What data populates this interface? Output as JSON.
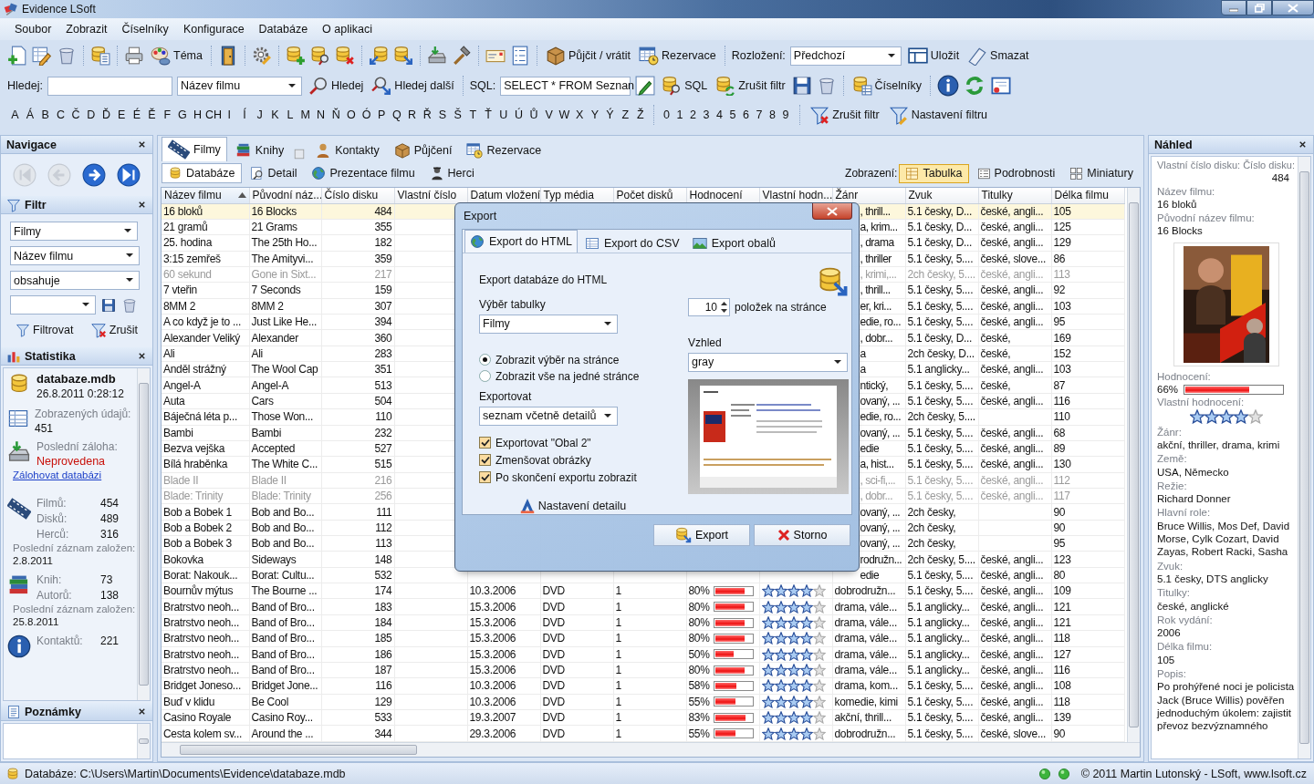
{
  "window": {
    "title": "Evidence LSoft"
  },
  "menu": [
    "Soubor",
    "Zobrazit",
    "Číselníky",
    "Konfigurace",
    "Databáze",
    "O aplikaci"
  ],
  "toolbar": {
    "theme": "Téma",
    "lend": "Půjčit / vrátit",
    "reserve": "Rezervace",
    "layout_label": "Rozložení:",
    "layout_value": "Předchozí",
    "save": "Uložit",
    "delete": "Smazat"
  },
  "search_bar": {
    "label": "Hledej:",
    "column": "Název filmu",
    "find": "Hledej",
    "find_next": "Hledej další",
    "sql_label": "SQL:",
    "sql_value": "SELECT * FROM Seznan",
    "sql": "SQL",
    "clear": "Zrušit filtr",
    "lists": "Číselníky"
  },
  "letters": [
    "A",
    "Á",
    "B",
    "C",
    "Č",
    "D",
    "Ď",
    "E",
    "É",
    "Ě",
    "F",
    "G",
    "H",
    "CH",
    "I",
    "Í",
    "J",
    "K",
    "L",
    "M",
    "N",
    "Ň",
    "O",
    "Ó",
    "P",
    "Q",
    "R",
    "Ř",
    "S",
    "Š",
    "T",
    "Ť",
    "U",
    "Ú",
    "Ů",
    "V",
    "W",
    "X",
    "Y",
    "Ý",
    "Z",
    "Ž"
  ],
  "digits": [
    "0",
    "1",
    "2",
    "3",
    "4",
    "5",
    "6",
    "7",
    "8",
    "9"
  ],
  "letter_filter": {
    "clear": "Zrušit filtr",
    "settings": "Nastavení filtru"
  },
  "navigation": {
    "title": "Navigace",
    "buttons": [
      {
        "disabled": true
      },
      {
        "disabled": true
      },
      {
        "disabled": false
      },
      {
        "disabled": false
      }
    ]
  },
  "filter": {
    "title": "Filtr",
    "table": "Filmy",
    "column": "Název filmu",
    "operator": "obsahuje",
    "apply": "Filtrovat",
    "clear": "Zrušit"
  },
  "statistics": {
    "title": "Statistika",
    "database": "databaze.mdb",
    "timestamp": "26.8.2011 0:28:12",
    "shown_label": "Zobrazených údajů:",
    "shown": "451",
    "backup_label": "Poslední záloha:",
    "backup": "Neprovedena",
    "backup_link": "Zálohovat databázi",
    "groups": [
      {
        "stats": [
          {
            "label": "Filmů:",
            "value": "454"
          },
          {
            "label": "Disků:",
            "value": "489"
          },
          {
            "label": "Herců:",
            "value": "316"
          }
        ],
        "last_label": "Poslední záznam založen:",
        "last": "2.8.2011"
      },
      {
        "stats": [
          {
            "label": "Knih:",
            "value": "73"
          },
          {
            "label": "Autorů:",
            "value": "138"
          }
        ],
        "last_label": "Poslední záznam založen:",
        "last": "25.8.2011"
      },
      {
        "stats": [
          {
            "label": "Kontaktů:",
            "value": "221"
          }
        ]
      }
    ]
  },
  "notes": {
    "title": "Poznámky"
  },
  "tabs": [
    {
      "label": "Filmy",
      "selected": true
    },
    {
      "label": "Knihy",
      "selected": false
    },
    {
      "label": "Kontakty",
      "selected": false
    },
    {
      "label": "Půjčení",
      "selected": false
    },
    {
      "label": "Rezervace",
      "selected": false
    }
  ],
  "subtabs": [
    {
      "label": "Databáze",
      "selected": true
    },
    {
      "label": "Detail",
      "selected": false
    },
    {
      "label": "Prezentace filmu",
      "selected": false
    },
    {
      "label": "Herci",
      "selected": false
    }
  ],
  "view_label": "Zobrazení:",
  "views": [
    {
      "label": "Tabulka",
      "selected": true
    },
    {
      "label": "Podrobnosti",
      "selected": false
    },
    {
      "label": "Miniatury",
      "selected": false
    }
  ],
  "table": {
    "columns": [
      {
        "label": "Název filmu",
        "sorted": true
      },
      {
        "label": "Původní náz...",
        "sorted": false
      },
      {
        "label": "Číslo disku",
        "sorted": false
      },
      {
        "label": "Vlastní číslo",
        "sorted": false
      },
      {
        "label": "Datum vložení",
        "sorted": false
      },
      {
        "label": "Typ média",
        "sorted": false
      },
      {
        "label": "Počet disků",
        "sorted": false
      },
      {
        "label": "Hodnocení",
        "sorted": false
      },
      {
        "label": "Vlastní hodn...",
        "sorted": false
      },
      {
        "label": "Žánr",
        "sorted": false
      },
      {
        "label": "Zvuk",
        "sorted": false
      },
      {
        "label": "Titulky",
        "sorted": false
      },
      {
        "label": "Délka filmu",
        "sorted": false
      }
    ],
    "rows": [
      {
        "title": "16 bloků",
        "original": "16 Blocks",
        "disc": "484",
        "genre": ", thrill...",
        "sound": "5.1 česky, D...",
        "subtitles": "české, angli...",
        "length": "105",
        "selected": true,
        "greyed": false
      },
      {
        "title": "21 gramů",
        "original": "21 Grams",
        "disc": "355",
        "genre": "a, krim...",
        "sound": "5.1 česky, D...",
        "subtitles": "české, angli...",
        "length": "125",
        "selected": false,
        "greyed": false
      },
      {
        "title": "25. hodina",
        "original": "The 25th Ho...",
        "disc": "182",
        "genre": ", drama",
        "sound": "5.1 česky, D...",
        "subtitles": "české, angli...",
        "length": "129",
        "selected": false,
        "greyed": false
      },
      {
        "title": "3:15 zemřeš",
        "original": "The Amityvi...",
        "disc": "359",
        "genre": ", thriller",
        "sound": "5.1 česky, 5....",
        "subtitles": "české, slove...",
        "length": "86",
        "selected": false,
        "greyed": false
      },
      {
        "title": "60 sekund",
        "original": "Gone in Sixt...",
        "disc": "217",
        "genre": ", krimi,...",
        "sound": "2ch česky, 5....",
        "subtitles": "české, angli...",
        "length": "113",
        "selected": false,
        "greyed": true
      },
      {
        "title": "7 vteřin",
        "original": "7 Seconds",
        "disc": "159",
        "genre": ", thrill...",
        "sound": "5.1 česky, 5....",
        "subtitles": "české, angli...",
        "length": "92",
        "selected": false,
        "greyed": false
      },
      {
        "title": "8MM 2",
        "original": "8MM 2",
        "disc": "307",
        "genre": "er, kri...",
        "sound": "5.1 česky, 5....",
        "subtitles": "české, angli...",
        "length": "103",
        "selected": false,
        "greyed": false
      },
      {
        "title": "A co když je to ...",
        "original": "Just Like He...",
        "disc": "394",
        "genre": "edie, ro...",
        "sound": "5.1 česky, 5....",
        "subtitles": "české, angli...",
        "length": "95",
        "selected": false,
        "greyed": false
      },
      {
        "title": "Alexander Veliký",
        "original": "Alexander",
        "disc": "360",
        "genre": ", dobr...",
        "sound": "5.1 česky, D...",
        "subtitles": "české,",
        "length": "169",
        "selected": false,
        "greyed": false
      },
      {
        "title": "Ali",
        "original": "Ali",
        "disc": "283",
        "genre": "a",
        "sound": "2ch česky, D...",
        "subtitles": "české,",
        "length": "152",
        "selected": false,
        "greyed": false
      },
      {
        "title": "Anděl strážný",
        "original": "The Wool Cap",
        "disc": "351",
        "genre": "a",
        "sound": "5.1 anglicky...",
        "subtitles": "české, angli...",
        "length": "103",
        "selected": false,
        "greyed": false
      },
      {
        "title": "Angel-A",
        "original": "Angel-A",
        "disc": "513",
        "genre": "ntický,",
        "sound": "5.1 česky, 5....",
        "subtitles": "české,",
        "length": "87",
        "selected": false,
        "greyed": false
      },
      {
        "title": "Auta",
        "original": "Cars",
        "disc": "504",
        "genre": "ovaný, ...",
        "sound": "5.1 česky, 5....",
        "subtitles": "české, angli...",
        "length": "116",
        "selected": false,
        "greyed": false
      },
      {
        "title": "Báječná léta p...",
        "original": "Those Won...",
        "disc": "110",
        "genre": "edie, ro...",
        "sound": "2ch česky, 5....",
        "length": "110",
        "selected": false,
        "greyed": false
      },
      {
        "title": "Bambi",
        "original": "Bambi",
        "disc": "232",
        "genre": "ovaný, ...",
        "sound": "5.1 česky, 5....",
        "subtitles": "české, angli...",
        "length": "68",
        "selected": false,
        "greyed": false
      },
      {
        "title": "Bezva vejška",
        "original": "Accepted",
        "disc": "527",
        "genre": "edie",
        "sound": "5.1 česky, 5....",
        "subtitles": "české, angli...",
        "length": "89",
        "selected": false,
        "greyed": false
      },
      {
        "title": "Bílá hraběnka",
        "original": "The White C...",
        "disc": "515",
        "genre": "a, hist...",
        "sound": "5.1 česky, 5....",
        "subtitles": "české, angli...",
        "length": "130",
        "selected": false,
        "greyed": false
      },
      {
        "title": "Blade II",
        "original": "Blade II",
        "disc": "216",
        "genre": ", sci-fi,...",
        "sound": "5.1 česky, 5....",
        "subtitles": "české, angli...",
        "length": "112",
        "selected": false,
        "greyed": true
      },
      {
        "title": "Blade: Trinity",
        "original": "Blade: Trinity",
        "disc": "256",
        "genre": ", dobr...",
        "sound": "5.1 česky, 5....",
        "subtitles": "české, angli...",
        "length": "117",
        "selected": false,
        "greyed": true
      },
      {
        "title": "Bob a Bobek 1",
        "original": "Bob and Bo...",
        "disc": "111",
        "genre": "ovaný, ...",
        "sound": "2ch česky,",
        "length": "90",
        "selected": false,
        "greyed": false
      },
      {
        "title": "Bob a Bobek 2",
        "original": "Bob and Bo...",
        "disc": "112",
        "genre": "ovaný, ...",
        "sound": "2ch česky,",
        "length": "90",
        "selected": false,
        "greyed": false
      },
      {
        "title": "Bob a Bobek 3",
        "original": "Bob and Bo...",
        "disc": "113",
        "genre": "ovaný, ...",
        "sound": "2ch česky,",
        "length": "95",
        "selected": false,
        "greyed": false
      },
      {
        "title": "Bokovka",
        "original": "Sideways",
        "disc": "148",
        "genre": "rodružn...",
        "sound": "2ch česky, 5....",
        "subtitles": "české, angli...",
        "length": "123",
        "selected": false,
        "greyed": false
      },
      {
        "title": "Borat: Nakouk...",
        "original": "Borat: Cultu...",
        "disc": "532",
        "genre": "edie",
        "sound": "5.1 česky, 5....",
        "subtitles": "české, angli...",
        "length": "80",
        "selected": false,
        "greyed": false
      },
      {
        "title": "Bournův mýtus",
        "original": "The Bourne ...",
        "disc": "174",
        "added": "10.3.2006",
        "media": "DVD",
        "discs": "1",
        "rating": "80%",
        "level": 0.8,
        "stars": 4,
        "genre": "dobrodružn...",
        "sound": "5.1 česky, 5....",
        "subtitles": "české, angli...",
        "length": "109",
        "selected": false,
        "greyed": false
      },
      {
        "title": "Bratrstvo neoh...",
        "original": "Band of Bro...",
        "disc": "183",
        "added": "15.3.2006",
        "media": "DVD",
        "discs": "1",
        "rating": "80%",
        "level": 0.8,
        "stars": 4,
        "genre": "drama, vále...",
        "sound": "5.1 anglicky...",
        "subtitles": "české, angli...",
        "length": "121",
        "selected": false,
        "greyed": false
      },
      {
        "title": "Bratrstvo neoh...",
        "original": "Band of Bro...",
        "disc": "184",
        "added": "15.3.2006",
        "media": "DVD",
        "discs": "1",
        "rating": "80%",
        "level": 0.8,
        "stars": 4,
        "genre": "drama, vále...",
        "sound": "5.1 anglicky...",
        "subtitles": "české, angli...",
        "length": "121",
        "selected": false,
        "greyed": false
      },
      {
        "title": "Bratrstvo neoh...",
        "original": "Band of Bro...",
        "disc": "185",
        "added": "15.3.2006",
        "media": "DVD",
        "discs": "1",
        "rating": "80%",
        "level": 0.8,
        "stars": 4,
        "genre": "drama, vále...",
        "sound": "5.1 anglicky...",
        "subtitles": "české, angli...",
        "length": "118",
        "selected": false,
        "greyed": false
      },
      {
        "title": "Bratrstvo neoh...",
        "original": "Band of Bro...",
        "disc": "186",
        "added": "15.3.2006",
        "media": "DVD",
        "discs": "1",
        "rating": "50%",
        "level": 0.5,
        "stars": 4,
        "genre": "drama, vále...",
        "sound": "5.1 anglicky...",
        "subtitles": "české, angli...",
        "length": "127",
        "selected": false,
        "greyed": false
      },
      {
        "title": "Bratrstvo neoh...",
        "original": "Band of Bro...",
        "disc": "187",
        "added": "15.3.2006",
        "media": "DVD",
        "discs": "1",
        "rating": "80%",
        "level": 0.8,
        "stars": 4,
        "genre": "drama, vále...",
        "sound": "5.1 anglicky...",
        "subtitles": "české, angli...",
        "length": "116",
        "selected": false,
        "greyed": false
      },
      {
        "title": "Bridget Joneso...",
        "original": "Bridget Jone...",
        "disc": "116",
        "added": "10.3.2006",
        "media": "DVD",
        "discs": "1",
        "rating": "58%",
        "level": 0.58,
        "stars": 4,
        "genre": "drama, kom...",
        "sound": "5.1 česky, 5....",
        "subtitles": "české, angli...",
        "length": "108",
        "selected": false,
        "greyed": false
      },
      {
        "title": "Buď v klidu",
        "original": "Be Cool",
        "disc": "129",
        "added": "10.3.2006",
        "media": "DVD",
        "discs": "1",
        "rating": "55%",
        "level": 0.55,
        "stars": 4,
        "genre": "komedie, kimi",
        "sound": "5.1 česky, 5....",
        "subtitles": "české, angli...",
        "length": "118",
        "selected": false,
        "greyed": false
      },
      {
        "title": "Casino Royale",
        "original": "Casino Roy...",
        "disc": "533",
        "added": "19.3.2007",
        "media": "DVD",
        "discs": "1",
        "rating": "83%",
        "level": 0.83,
        "stars": 4,
        "genre": "akční, thrill...",
        "sound": "5.1 česky, 5....",
        "subtitles": "české, angli...",
        "length": "139",
        "selected": false,
        "greyed": false
      },
      {
        "title": "Cesta kolem sv...",
        "original": "Around the ...",
        "disc": "344",
        "added": "29.3.2006",
        "media": "DVD",
        "discs": "1",
        "rating": "55%",
        "level": 0.55,
        "stars": 4,
        "genre": "dobrodružn...",
        "sound": "5.1 česky, 5....",
        "subtitles": "české, slove...",
        "length": "90",
        "selected": false,
        "greyed": false
      }
    ]
  },
  "dialog": {
    "title": "Export",
    "tabs": [
      {
        "label": "Export do HTML",
        "selected": true
      },
      {
        "label": "Export do CSV",
        "selected": false
      },
      {
        "label": "Export obalů",
        "selected": false
      }
    ],
    "heading": "Export databáze do HTML",
    "table_label": "Výběr tabulky",
    "table": "Filmy",
    "per_page": "10",
    "per_page_label": "položek na stránce",
    "display": [
      {
        "label": "Zobrazit výběr na stránce",
        "selected": true
      },
      {
        "label": "Zobrazit vše na jedné stránce",
        "selected": false
      }
    ],
    "style_label": "Vzhled",
    "style": "gray",
    "export_label": "Exportovat",
    "export": "seznam včetně detailů",
    "options": [
      {
        "label": "Exportovat \"Obal 2\"",
        "checked": true
      },
      {
        "label": "Zmenšovat obrázky",
        "checked": true
      },
      {
        "label": "Po skončení exportu zobrazit",
        "checked": true
      }
    ],
    "detail_settings": "Nastavení detailu",
    "buttons": [
      "Export",
      "Storno"
    ]
  },
  "preview": {
    "title": "Náhled",
    "fields": [
      {
        "kind": "disc",
        "label": "Vlastní číslo disku:",
        "label_2": "Číslo disku:",
        "value": "484"
      },
      {
        "kind": "text",
        "label": "Název filmu:",
        "value": "16 bloků"
      },
      {
        "kind": "text",
        "label": "Původní název filmu:",
        "value": "16 Blocks"
      },
      {
        "kind": "picture"
      },
      {
        "kind": "rating",
        "label": "Hodnocení:",
        "value": "66%",
        "level": 0.66
      },
      {
        "kind": "stars",
        "label": "Vlastní hodnocení:",
        "stars": 4
      },
      {
        "kind": "text",
        "label": "Žánr:",
        "value": "akční, thriller, drama, krimi"
      },
      {
        "kind": "text",
        "label": "Země:",
        "value": "USA, Německo"
      },
      {
        "kind": "text",
        "label": "Režie:",
        "value": "Richard Donner"
      },
      {
        "kind": "text",
        "label": "Hlavní role:",
        "value": "Bruce Willis, Mos Def, David Morse, Cylk Cozart, David Zayas, Robert Racki, Sasha"
      },
      {
        "kind": "text",
        "label": "Zvuk:",
        "value": "5.1 česky, DTS anglicky"
      },
      {
        "kind": "text",
        "label": "Titulky:",
        "value": "české, anglické"
      },
      {
        "kind": "text",
        "label": "Rok vydání:",
        "value": "2006"
      },
      {
        "kind": "text",
        "label": "Délka filmu:",
        "value": "105"
      },
      {
        "kind": "text",
        "label": "Popis:",
        "value": "Po prohýřené noci je policista Jack (Bruce Willis) pověřen jednoduchým úkolem: zajistit převoz bezvýznamného"
      }
    ]
  },
  "status_bar": {
    "path": "Databáze: C:\\Users\\Martin\\Documents\\Evidence\\databaze.mdb",
    "copyright": "© 2011 Martin Lutonský - LSoft, www.lsoft.cz"
  }
}
